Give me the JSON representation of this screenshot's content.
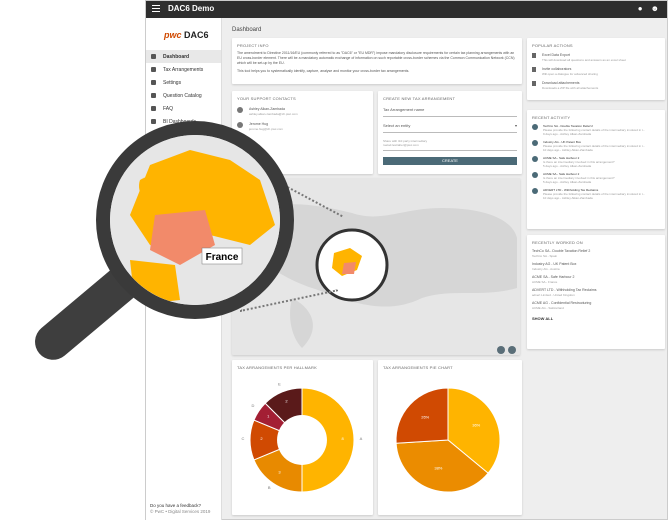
{
  "topbar": {
    "title": "DAC6 Demo"
  },
  "logo": {
    "pwc": "pwc",
    "name": "DAC6"
  },
  "sidebar": {
    "items": [
      {
        "label": "Dashboard",
        "active": true
      },
      {
        "label": "Tax Arrangements"
      },
      {
        "label": "Settings"
      },
      {
        "label": "Question Catalog"
      },
      {
        "label": "FAQ"
      },
      {
        "label": "BI Dashboards"
      }
    ],
    "feedback_title": "Do you have a feedback?",
    "feedback_sub": "© PwC • Digital Services 2019"
  },
  "main": {
    "title": "Dashboard"
  },
  "project_info": {
    "heading": "PROJECT INFO",
    "p1": "The amendment to Directive 2011/16/EU (commonly referred to as \"DAC6\" or \"EU MDR\") impose mandatory disclosure requirements for certain tax planning arrangements with an EU cross-border element. There will be a mandatory automatic exchange of information on such reportable cross-border schemes via the Common Communication Network (CCN) which will be set-up by the EU.",
    "p2": "This tool helps you to systematically identify, capture, analyse and monitor your cross-border tax arrangements."
  },
  "contacts": {
    "heading": "YOUR SUPPORT CONTACTS",
    "people": [
      {
        "name": "Ashley Alkan-Zambada",
        "email": "ashley.alkan-zambada@ch.pwc.com"
      },
      {
        "name": "Jerome Hug",
        "email": "jerome.hug@ch.pwc.com"
      }
    ]
  },
  "create": {
    "heading": "CREATE NEW TAX ARRANGEMENT",
    "name_placeholder": "Tax Arrangement name",
    "entity_placeholder": "Select an entity",
    "share_label": "Share with 3rd party intermediary",
    "share_value": "roelod.lestraher@pwc.com",
    "button": "CREATE"
  },
  "popular": {
    "heading": "POPULAR ACTIONS",
    "items": [
      {
        "title": "Excel Data Export",
        "desc": "This will download all questions and answers as an excel sheet"
      },
      {
        "title": "Invite collaborators",
        "desc": "Will open a dialogue for advanced sharing"
      },
      {
        "title": "Download attachements",
        "desc": "Downloads a ZIP file with all attachements"
      }
    ]
  },
  "recent": {
    "heading": "RECENT ACTIVITY",
    "items": [
      {
        "title": "TechCo SA - Double Taxation Relief 2",
        "desc": "Please provide the following contact details of the intermediary involved in t...",
        "time": "9 days ago - Ashley Alkan-Zambada"
      },
      {
        "title": "Industry AG - UK Patent Box",
        "desc": "Please provide the following contact details of the intermediary involved in t...",
        "time": "10 days ago - Ashley Alkan-Zambada"
      },
      {
        "title": "ACME SA - Safe Harbour 2",
        "desc": "Is there an intermediary involved in this arrangement?",
        "time": "5 days ago - Ashley Alkan-Zambada"
      },
      {
        "title": "ACME SA - Safe Harbour 2",
        "desc": "Is there an intermediary involved in this arrangement?",
        "time": "5 days ago - Ashley Alkan-Zambada"
      },
      {
        "title": "ADVERT LTD - Withholding Tax Reclaims",
        "desc": "Please provide the following contact details of the intermediary involved in t...",
        "time": "10 days ago - Ashley Alkan-Zambada"
      }
    ]
  },
  "worked": {
    "heading": "RECENTLY WORKED ON",
    "items": [
      {
        "title": "TechCo SA - Double Taxation Relief 2",
        "sub": "TechCo SA - Spain"
      },
      {
        "title": "Industry AG - UK Patent Box",
        "sub": "Industry AG - Austria"
      },
      {
        "title": "ACME SA - Safe Harbour 2",
        "sub": "ACME SA - France"
      },
      {
        "title": "ADVERT LTD - Withholding Tax Reclaims",
        "sub": "advert Limited - United Kingdom"
      },
      {
        "title": "ACME AG - Confidential Restructuring",
        "sub": "ACME AG - Switzerland"
      }
    ],
    "show_all": "SHOW ALL"
  },
  "map": {
    "callout": "France"
  },
  "charts": {
    "halfway_title": "TAX ARRANGEMENTS PER HALLMARK",
    "pie_title": "TAX ARRANGEMENTS PIE CHART"
  },
  "chart_data": [
    {
      "type": "pie",
      "donut": true,
      "title": "TAX ARRANGEMENTS PER HALLMARK",
      "categories": [
        "A",
        "B",
        "C",
        "D",
        "E"
      ],
      "values": [
        8,
        3,
        2,
        1,
        2
      ],
      "colors": [
        "#ffb400",
        "#e88a00",
        "#d04a02",
        "#a31f34",
        "#5a1a1a"
      ]
    },
    {
      "type": "pie",
      "title": "TAX ARRANGEMENTS PIE CHART",
      "categories": [
        "",
        "",
        ""
      ],
      "values": [
        36,
        38,
        26
      ],
      "labels": [
        "36%",
        "38%",
        "26%"
      ],
      "colors": [
        "#ffb400",
        "#eb8c00",
        "#d04a02"
      ]
    }
  ],
  "colors": {
    "accent": "#4b6a77",
    "topbar": "#2e2e2e",
    "france": "#f28a6a",
    "europe": "#ffb400"
  }
}
